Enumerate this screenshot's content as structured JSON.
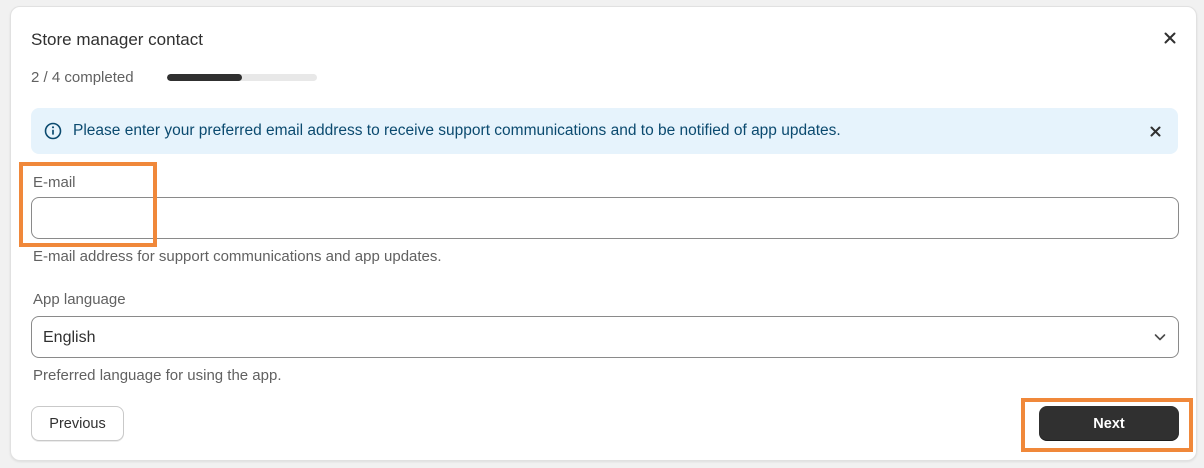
{
  "modal": {
    "title": "Store manager contact",
    "close_icon": "close-icon"
  },
  "progress": {
    "label": "2 / 4 completed",
    "completed": 2,
    "total": 4,
    "fraction": 0.5
  },
  "banner": {
    "icon": "info-icon",
    "text": "Please enter your preferred email address to receive support communications and to be notified of app updates.",
    "close_icon": "close-icon"
  },
  "email": {
    "label": "E-mail",
    "value": "",
    "help": "E-mail address for support communications and app updates."
  },
  "language": {
    "label": "App language",
    "selected": "English",
    "help": "Preferred language for using the app.",
    "icon": "chevron-down-icon"
  },
  "buttons": {
    "previous": "Previous",
    "next": "Next"
  },
  "colors": {
    "highlight": "#f0883a",
    "primary": "#303030",
    "banner_bg": "#e6f3fc",
    "banner_text": "#0b4a6f"
  }
}
